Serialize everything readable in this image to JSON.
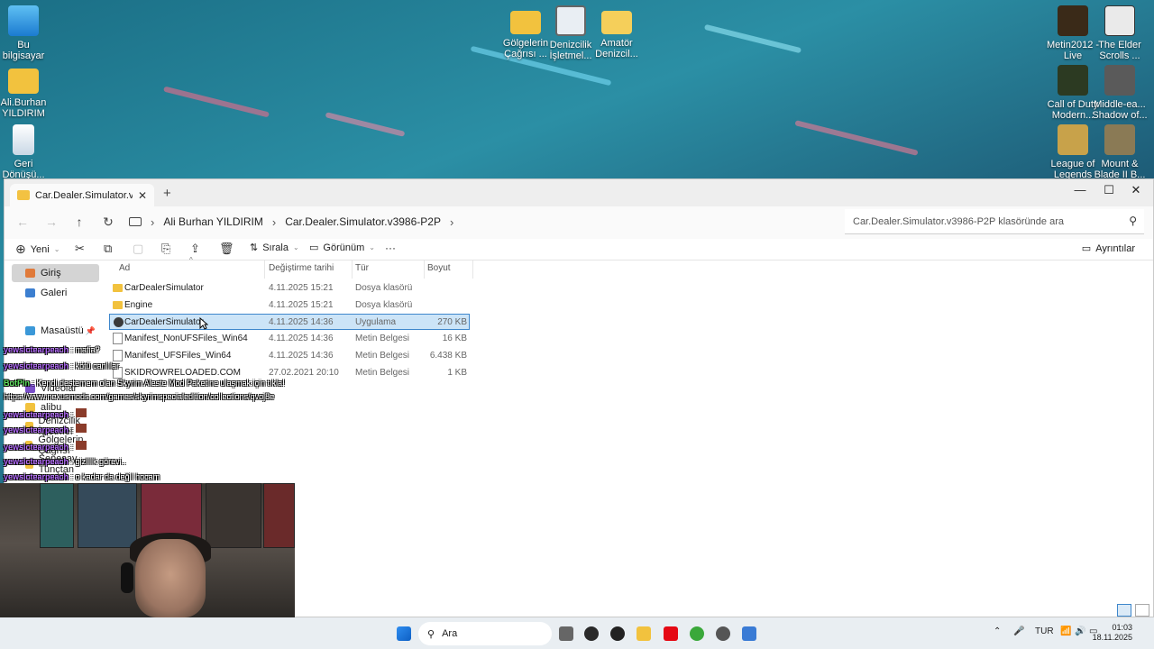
{
  "desktop": {
    "icons_left": [
      {
        "label": "Bu\nbilgisayar",
        "icon": "computer-icon"
      },
      {
        "label": "Ali.Burhan\nYILDIRIM",
        "icon": "folder-icon"
      },
      {
        "label": "Geri\nDönüşü...",
        "icon": "recycle-bin-icon"
      }
    ],
    "icons_top": [
      {
        "label": "Gölgelerin\nÇağrısı ...",
        "icon": "folder-icon"
      },
      {
        "label": "Denizcilik\nİşletmel...",
        "icon": "document-icon"
      },
      {
        "label": "Amatör\nDenizcil...",
        "icon": "folder-icon"
      }
    ],
    "icons_right": [
      {
        "label": "Metin2012 -\nLive",
        "icon": "game-icon"
      },
      {
        "label": "The Elder\nScrolls ...",
        "icon": "game-icon"
      },
      {
        "label": "Call of Duty\nModern...",
        "icon": "game-icon"
      },
      {
        "label": "Middle-ea...\nShadow of...",
        "icon": "game-icon"
      },
      {
        "label": "League of\nLegends",
        "icon": "game-icon"
      },
      {
        "label": "Mount &\nBlade II B...",
        "icon": "game-icon"
      }
    ]
  },
  "window": {
    "tab_title": "Car.Dealer.Simulator.v3986-P2P",
    "tab_close": "✕",
    "new_tab": "+",
    "controls": {
      "minimize": "—",
      "maximize": "☐",
      "close": "✕"
    },
    "nav": {
      "back": "←",
      "forward": "→",
      "up": "↑",
      "refresh": "↻"
    },
    "breadcrumb": [
      "Ali Burhan YILDIRIM",
      "Car.Dealer.Simulator.v3986-P2P"
    ],
    "breadcrumb_sep": "›",
    "search_placeholder": "Car.Dealer.Simulator.v3986-P2P klasöründe ara",
    "commands": {
      "new": "Yeni",
      "sort": "Sırala",
      "view": "Görünüm",
      "more": "···",
      "details": "Ayrıntılar"
    },
    "sidebar": [
      {
        "label": "Giriş",
        "selected": true
      },
      {
        "label": "Galeri",
        "selected": false
      },
      {
        "label": "Masaüstü",
        "selected": false
      },
      {
        "label": "Videolar",
        "selected": false
      },
      {
        "label": "alibu",
        "selected": false
      },
      {
        "label": "Denizcilik İşletmel",
        "selected": false
      },
      {
        "label": "Gölgelerin Çağrısı",
        "selected": false
      },
      {
        "label": "Şenesay Tunçtan",
        "selected": false
      }
    ],
    "columns": [
      "Ad",
      "Değiştirme tarihi",
      "Tür",
      "Boyut"
    ],
    "files": [
      {
        "name": "CarDealerSimulator",
        "date": "4.11.2025 15:21",
        "type": "Dosya klasörü",
        "size": "",
        "kind": "folder",
        "selected": false
      },
      {
        "name": "Engine",
        "date": "4.11.2025 15:21",
        "type": "Dosya klasörü",
        "size": "",
        "kind": "folder",
        "selected": false
      },
      {
        "name": "CarDealerSimulator",
        "date": "4.11.2025 14:36",
        "type": "Uygulama",
        "size": "270 KB",
        "kind": "app",
        "selected": true
      },
      {
        "name": "Manifest_NonUFSFiles_Win64",
        "date": "4.11.2025 14:36",
        "type": "Metin Belgesi",
        "size": "16 KB",
        "kind": "doc",
        "selected": false
      },
      {
        "name": "Manifest_UFSFiles_Win64",
        "date": "4.11.2025 14:36",
        "type": "Metin Belgesi",
        "size": "6.438 KB",
        "kind": "doc",
        "selected": false
      },
      {
        "name": "SKIDROWRELOADED.COM",
        "date": "27.02.2021 20:10",
        "type": "Metin Belgesi",
        "size": "1 KB",
        "kind": "doc",
        "selected": false
      }
    ]
  },
  "chat": [
    {
      "user": "yewsictearpeach",
      "text": ": mafia?",
      "green": false
    },
    {
      "user": "yewsictearpeach",
      "text": ": kötü canlılar",
      "green": false
    },
    {
      "user": "BotPin",
      "text": ": Kendi deştemem olan Skyrim Aleste Mod Paketine ulaşmak için tıkla!",
      "green": true
    },
    {
      "user": "",
      "text": "https://www.nexusmods.com/games/skyrimspecialedition/collections/qvoj8e",
      "green": false
    },
    {
      "user": "yewsictearpeach",
      "text": ":",
      "green": false
    },
    {
      "user": "yewsictearpeach",
      "text": ":",
      "green": false
    },
    {
      "user": "yewsictearpeach",
      "text": ":",
      "green": false
    },
    {
      "user": "yewsictearpeach",
      "text": ": gizlilik görevi..",
      "green": false
    },
    {
      "user": "yewsictearpeach",
      "text": ": o kadar da değil hocam",
      "green": false
    }
  ],
  "taskbar": {
    "search_placeholder": "Ara",
    "language": "TUR",
    "time": "01:03",
    "date": "18.11.2025"
  }
}
